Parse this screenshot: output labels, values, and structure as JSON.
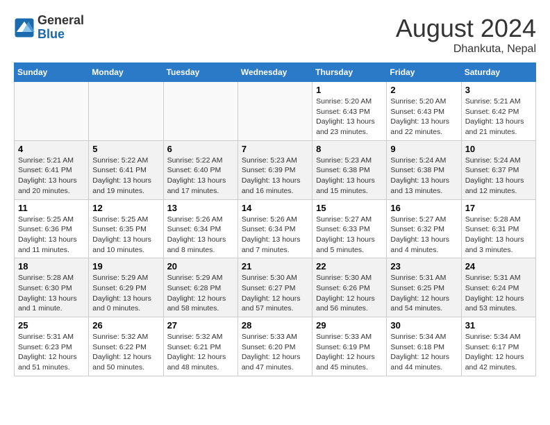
{
  "header": {
    "logo_line1": "General",
    "logo_line2": "Blue",
    "month": "August 2024",
    "location": "Dhankuta, Nepal"
  },
  "days_of_week": [
    "Sunday",
    "Monday",
    "Tuesday",
    "Wednesday",
    "Thursday",
    "Friday",
    "Saturday"
  ],
  "weeks": [
    [
      {
        "day": "",
        "info": ""
      },
      {
        "day": "",
        "info": ""
      },
      {
        "day": "",
        "info": ""
      },
      {
        "day": "",
        "info": ""
      },
      {
        "day": "1",
        "info": "Sunrise: 5:20 AM\nSunset: 6:43 PM\nDaylight: 13 hours\nand 23 minutes."
      },
      {
        "day": "2",
        "info": "Sunrise: 5:20 AM\nSunset: 6:43 PM\nDaylight: 13 hours\nand 22 minutes."
      },
      {
        "day": "3",
        "info": "Sunrise: 5:21 AM\nSunset: 6:42 PM\nDaylight: 13 hours\nand 21 minutes."
      }
    ],
    [
      {
        "day": "4",
        "info": "Sunrise: 5:21 AM\nSunset: 6:41 PM\nDaylight: 13 hours\nand 20 minutes."
      },
      {
        "day": "5",
        "info": "Sunrise: 5:22 AM\nSunset: 6:41 PM\nDaylight: 13 hours\nand 19 minutes."
      },
      {
        "day": "6",
        "info": "Sunrise: 5:22 AM\nSunset: 6:40 PM\nDaylight: 13 hours\nand 17 minutes."
      },
      {
        "day": "7",
        "info": "Sunrise: 5:23 AM\nSunset: 6:39 PM\nDaylight: 13 hours\nand 16 minutes."
      },
      {
        "day": "8",
        "info": "Sunrise: 5:23 AM\nSunset: 6:38 PM\nDaylight: 13 hours\nand 15 minutes."
      },
      {
        "day": "9",
        "info": "Sunrise: 5:24 AM\nSunset: 6:38 PM\nDaylight: 13 hours\nand 13 minutes."
      },
      {
        "day": "10",
        "info": "Sunrise: 5:24 AM\nSunset: 6:37 PM\nDaylight: 13 hours\nand 12 minutes."
      }
    ],
    [
      {
        "day": "11",
        "info": "Sunrise: 5:25 AM\nSunset: 6:36 PM\nDaylight: 13 hours\nand 11 minutes."
      },
      {
        "day": "12",
        "info": "Sunrise: 5:25 AM\nSunset: 6:35 PM\nDaylight: 13 hours\nand 10 minutes."
      },
      {
        "day": "13",
        "info": "Sunrise: 5:26 AM\nSunset: 6:34 PM\nDaylight: 13 hours\nand 8 minutes."
      },
      {
        "day": "14",
        "info": "Sunrise: 5:26 AM\nSunset: 6:34 PM\nDaylight: 13 hours\nand 7 minutes."
      },
      {
        "day": "15",
        "info": "Sunrise: 5:27 AM\nSunset: 6:33 PM\nDaylight: 13 hours\nand 5 minutes."
      },
      {
        "day": "16",
        "info": "Sunrise: 5:27 AM\nSunset: 6:32 PM\nDaylight: 13 hours\nand 4 minutes."
      },
      {
        "day": "17",
        "info": "Sunrise: 5:28 AM\nSunset: 6:31 PM\nDaylight: 13 hours\nand 3 minutes."
      }
    ],
    [
      {
        "day": "18",
        "info": "Sunrise: 5:28 AM\nSunset: 6:30 PM\nDaylight: 13 hours\nand 1 minute."
      },
      {
        "day": "19",
        "info": "Sunrise: 5:29 AM\nSunset: 6:29 PM\nDaylight: 13 hours\nand 0 minutes."
      },
      {
        "day": "20",
        "info": "Sunrise: 5:29 AM\nSunset: 6:28 PM\nDaylight: 12 hours\nand 58 minutes."
      },
      {
        "day": "21",
        "info": "Sunrise: 5:30 AM\nSunset: 6:27 PM\nDaylight: 12 hours\nand 57 minutes."
      },
      {
        "day": "22",
        "info": "Sunrise: 5:30 AM\nSunset: 6:26 PM\nDaylight: 12 hours\nand 56 minutes."
      },
      {
        "day": "23",
        "info": "Sunrise: 5:31 AM\nSunset: 6:25 PM\nDaylight: 12 hours\nand 54 minutes."
      },
      {
        "day": "24",
        "info": "Sunrise: 5:31 AM\nSunset: 6:24 PM\nDaylight: 12 hours\nand 53 minutes."
      }
    ],
    [
      {
        "day": "25",
        "info": "Sunrise: 5:31 AM\nSunset: 6:23 PM\nDaylight: 12 hours\nand 51 minutes."
      },
      {
        "day": "26",
        "info": "Sunrise: 5:32 AM\nSunset: 6:22 PM\nDaylight: 12 hours\nand 50 minutes."
      },
      {
        "day": "27",
        "info": "Sunrise: 5:32 AM\nSunset: 6:21 PM\nDaylight: 12 hours\nand 48 minutes."
      },
      {
        "day": "28",
        "info": "Sunrise: 5:33 AM\nSunset: 6:20 PM\nDaylight: 12 hours\nand 47 minutes."
      },
      {
        "day": "29",
        "info": "Sunrise: 5:33 AM\nSunset: 6:19 PM\nDaylight: 12 hours\nand 45 minutes."
      },
      {
        "day": "30",
        "info": "Sunrise: 5:34 AM\nSunset: 6:18 PM\nDaylight: 12 hours\nand 44 minutes."
      },
      {
        "day": "31",
        "info": "Sunrise: 5:34 AM\nSunset: 6:17 PM\nDaylight: 12 hours\nand 42 minutes."
      }
    ]
  ]
}
